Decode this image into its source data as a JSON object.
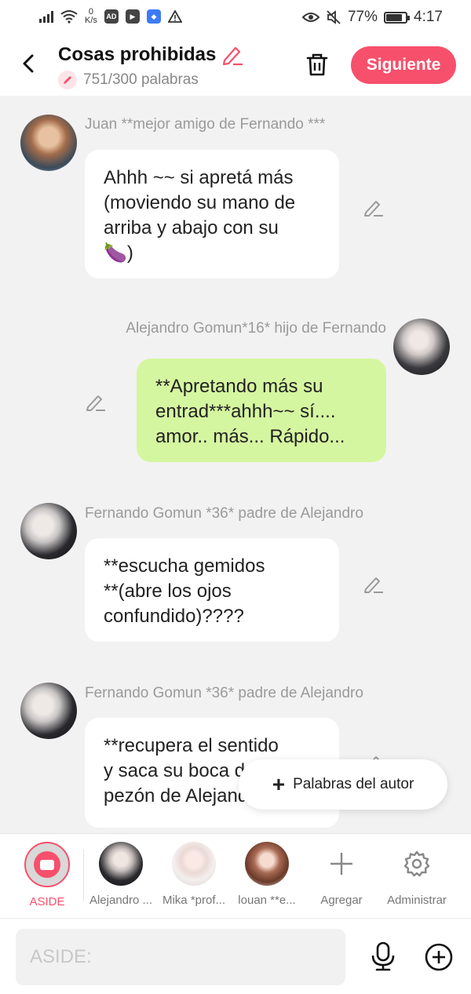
{
  "status_bar": {
    "net_speed_value": "0",
    "net_speed_unit": "K/s",
    "badge_ad": "AD",
    "battery_percent": "77%",
    "battery_level": 0.77,
    "time": "4:17"
  },
  "header": {
    "title": "Cosas prohibidas",
    "word_count": "751/300 palabras",
    "next_label": "Siguiente"
  },
  "messages": [
    {
      "sender": "Juan **mejor amigo de Fernando ***",
      "text": "Ahhh ~~ si apretá más\n(moviendo su mano de\narriba y abajo con su\n🍆)",
      "side": "left"
    },
    {
      "sender": "Alejandro Gomun*16* hijo de Fernando",
      "text": "**Apretando más su\nentrad***ahhh~~ sí....\namor.. más... Rápido...",
      "side": "right"
    },
    {
      "sender": "Fernando Gomun  *36* padre de Alejandro",
      "text": "**escucha gemidos\n**(abre los ojos\nconfundido)????",
      "side": "left"
    },
    {
      "sender": "Fernando Gomun  *36* padre de Alejandro",
      "text": "**recupera el sentido\ny saca su boca del\npezón de Alejandro",
      "side": "left"
    }
  ],
  "floating_button": {
    "label": "Palabras del autor"
  },
  "character_bar": {
    "items": [
      {
        "label": "ASIDE"
      },
      {
        "label": "Alejandro ..."
      },
      {
        "label": "Mika *prof..."
      },
      {
        "label": "louan **e..."
      },
      {
        "label": "Agregar"
      },
      {
        "label": "Administrar"
      }
    ]
  },
  "input_bar": {
    "placeholder": "ASIDE:"
  },
  "colors": {
    "accent": "#f7506c",
    "bubble_self": "#d5f6a0",
    "bubble_other": "#ffffff",
    "background": "#f2f2f2"
  }
}
